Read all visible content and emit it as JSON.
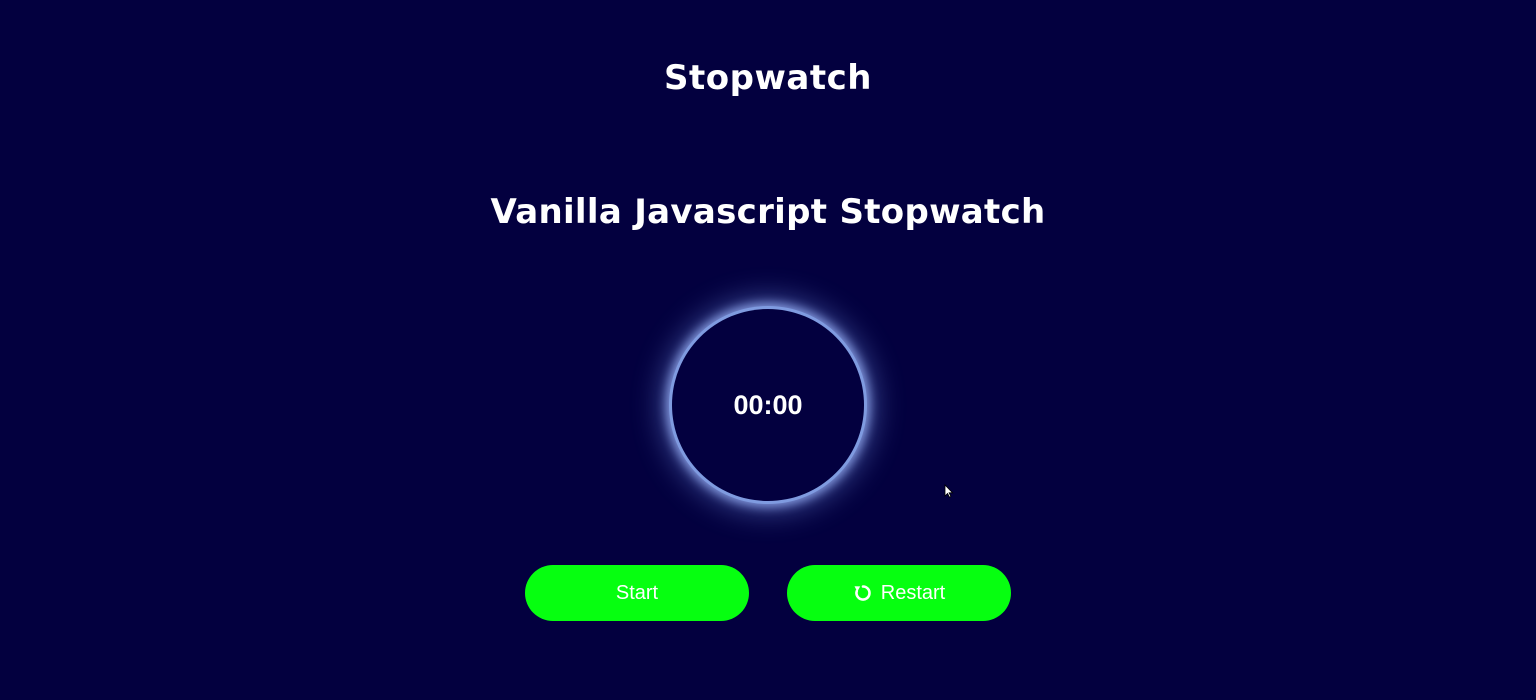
{
  "header": {
    "title": "Stopwatch"
  },
  "main": {
    "heading": "Vanilla Javascript Stopwatch",
    "timer": {
      "display": "00:00"
    },
    "buttons": {
      "start_label": "Start",
      "restart_label": "Restart",
      "restart_icon": "restart-icon"
    }
  },
  "colors": {
    "background": "#03003f",
    "button": "#06ff10",
    "dial_glow": "#7f9be0",
    "text": "#ffffff"
  }
}
